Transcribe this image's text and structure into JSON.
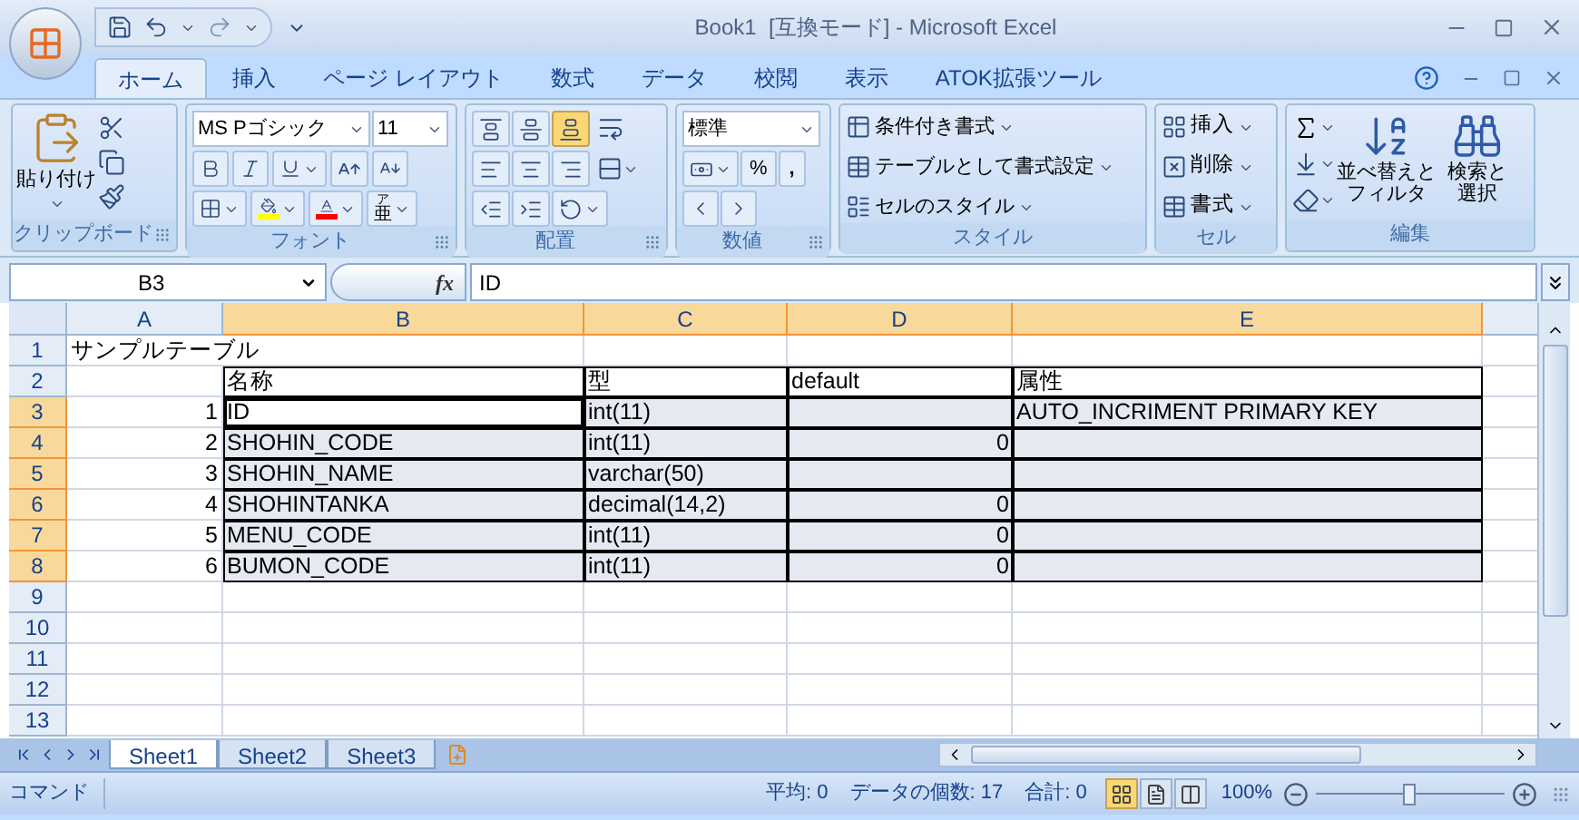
{
  "window": {
    "title": "Book1  [互換モード] - Microsoft Excel"
  },
  "ribbon_tabs": [
    {
      "label": "ホーム",
      "selected": true
    },
    {
      "label": "挿入",
      "selected": false
    },
    {
      "label": "ページ レイアウト",
      "selected": false
    },
    {
      "label": "数式",
      "selected": false
    },
    {
      "label": "データ",
      "selected": false
    },
    {
      "label": "校閲",
      "selected": false
    },
    {
      "label": "表示",
      "selected": false
    },
    {
      "label": "ATOK拡張ツール",
      "selected": false
    }
  ],
  "clipboard": {
    "label": "クリップボード",
    "paste": "貼り付け"
  },
  "font": {
    "label": "フォント",
    "font_name": "MS Pゴシック",
    "font_size": "11",
    "phonetic_ruby": "ア",
    "phonetic_base": "亜"
  },
  "alignment": {
    "label": "配置",
    "vertical": [
      {
        "kind": "top",
        "selected": false
      },
      {
        "kind": "middle",
        "selected": false
      },
      {
        "kind": "bottom",
        "selected": true
      }
    ]
  },
  "number": {
    "label": "数値",
    "format": "標準",
    "percent": "%",
    "comma": ","
  },
  "styles": {
    "label": "スタイル",
    "items": [
      "条件付き書式",
      "テーブルとして書式設定",
      "セルのスタイル"
    ]
  },
  "cells": {
    "label": "セル",
    "items": [
      "挿入",
      "削除",
      "書式"
    ]
  },
  "editing": {
    "label": "編集",
    "sort_filter": [
      "並べ替えと",
      "フィルタ"
    ],
    "find_select": [
      "検索と",
      "選択"
    ]
  },
  "formula_bar": {
    "name_box": "B3",
    "fx": "fx",
    "value": "ID"
  },
  "grid": {
    "columns": [
      {
        "label": "A",
        "selected": false
      },
      {
        "label": "B",
        "selected": true
      },
      {
        "label": "C",
        "selected": true
      },
      {
        "label": "D",
        "selected": true
      },
      {
        "label": "E",
        "selected": true
      }
    ],
    "rows": [
      {
        "header": "1",
        "selected": false,
        "cells": [
          {
            "text": "サンプルテーブル",
            "kind": "text",
            "bordered": false,
            "selected": false,
            "active": false
          }
        ]
      },
      {
        "header": "2",
        "selected": false,
        "cells": [
          {
            "bordered": false,
            "selected": false,
            "active": false
          },
          {
            "text": "名称",
            "kind": "text",
            "bordered": true,
            "selected": false,
            "active": false
          },
          {
            "text": "型",
            "kind": "text",
            "bordered": true,
            "selected": false,
            "active": false
          },
          {
            "text": "default",
            "kind": "text",
            "bordered": true,
            "selected": false,
            "active": false
          },
          {
            "text": "属性",
            "kind": "text",
            "bordered": true,
            "selected": false,
            "active": false
          }
        ]
      },
      {
        "header": "3",
        "selected": true,
        "cells": [
          {
            "text": "1",
            "kind": "number",
            "bordered": false,
            "selected": false,
            "active": false
          },
          {
            "text": "ID",
            "kind": "text",
            "bordered": true,
            "active": true
          },
          {
            "text": "int(11)",
            "kind": "text",
            "bordered": true,
            "selected": true,
            "active": false
          },
          {
            "bordered": true,
            "selected": true,
            "active": false
          },
          {
            "text": "AUTO_INCRIMENT PRIMARY KEY",
            "kind": "text",
            "bordered": true,
            "selected": true,
            "active": false
          }
        ]
      },
      {
        "header": "4",
        "selected": true,
        "cells": [
          {
            "text": "2",
            "kind": "number",
            "bordered": false,
            "selected": false,
            "active": false
          },
          {
            "text": "SHOHIN_CODE",
            "kind": "text",
            "bordered": true,
            "selected": true,
            "active": false
          },
          {
            "text": "int(11)",
            "kind": "text",
            "bordered": true,
            "selected": true,
            "active": false
          },
          {
            "text": "0",
            "kind": "number",
            "bordered": true,
            "selected": true,
            "active": false
          },
          {
            "bordered": true,
            "selected": true,
            "active": false
          }
        ]
      },
      {
        "header": "5",
        "selected": true,
        "cells": [
          {
            "text": "3",
            "kind": "number",
            "bordered": false,
            "selected": false,
            "active": false
          },
          {
            "text": "SHOHIN_NAME",
            "kind": "text",
            "bordered": true,
            "selected": true,
            "active": false
          },
          {
            "text": "varchar(50)",
            "kind": "text",
            "bordered": true,
            "selected": true,
            "active": false
          },
          {
            "bordered": true,
            "selected": true,
            "active": false
          },
          {
            "bordered": true,
            "selected": true,
            "active": false
          }
        ]
      },
      {
        "header": "6",
        "selected": true,
        "cells": [
          {
            "text": "4",
            "kind": "number",
            "bordered": false,
            "selected": false,
            "active": false
          },
          {
            "text": "SHOHINTANKA",
            "kind": "text",
            "bordered": true,
            "selected": true,
            "active": false
          },
          {
            "text": "decimal(14,2)",
            "kind": "text",
            "bordered": true,
            "selected": true,
            "active": false
          },
          {
            "text": "0",
            "kind": "number",
            "bordered": true,
            "selected": true,
            "active": false
          },
          {
            "bordered": true,
            "selected": true,
            "active": false
          }
        ]
      },
      {
        "header": "7",
        "selected": true,
        "cells": [
          {
            "text": "5",
            "kind": "number",
            "bordered": false,
            "selected": false,
            "active": false
          },
          {
            "text": "MENU_CODE",
            "kind": "text",
            "bordered": true,
            "selected": true,
            "active": false
          },
          {
            "text": "int(11)",
            "kind": "text",
            "bordered": true,
            "selected": true,
            "active": false
          },
          {
            "text": "0",
            "kind": "number",
            "bordered": true,
            "selected": true,
            "active": false
          },
          {
            "bordered": true,
            "selected": true,
            "active": false
          }
        ]
      },
      {
        "header": "8",
        "selected": true,
        "cells": [
          {
            "text": "6",
            "kind": "number",
            "bordered": false,
            "selected": false,
            "active": false
          },
          {
            "text": "BUMON_CODE",
            "kind": "text",
            "bordered": true,
            "selected": true,
            "active": false
          },
          {
            "text": "int(11)",
            "kind": "text",
            "bordered": true,
            "selected": true,
            "active": false
          },
          {
            "text": "0",
            "kind": "number",
            "bordered": true,
            "selected": true,
            "active": false
          },
          {
            "bordered": true,
            "selected": true,
            "active": false
          }
        ]
      },
      {
        "header": "9",
        "selected": false
      },
      {
        "header": "10",
        "selected": false
      },
      {
        "header": "11",
        "selected": false
      },
      {
        "header": "12",
        "selected": false
      },
      {
        "header": "13",
        "selected": false
      }
    ]
  },
  "sheet_tabs": [
    {
      "label": "Sheet1",
      "selected": true
    },
    {
      "label": "Sheet2",
      "selected": false
    },
    {
      "label": "Sheet3",
      "selected": false
    }
  ],
  "status_bar": {
    "mode": "コマンド",
    "average": "平均: 0",
    "count": "データの個数: 17",
    "sum": "合計: 0",
    "views": [
      {
        "kind": "normal",
        "selected": true
      },
      {
        "kind": "page_layout",
        "selected": false
      },
      {
        "kind": "page_break",
        "selected": false
      }
    ],
    "zoom": "100%",
    "zoom_slider": {
      "level": 0.5
    }
  }
}
